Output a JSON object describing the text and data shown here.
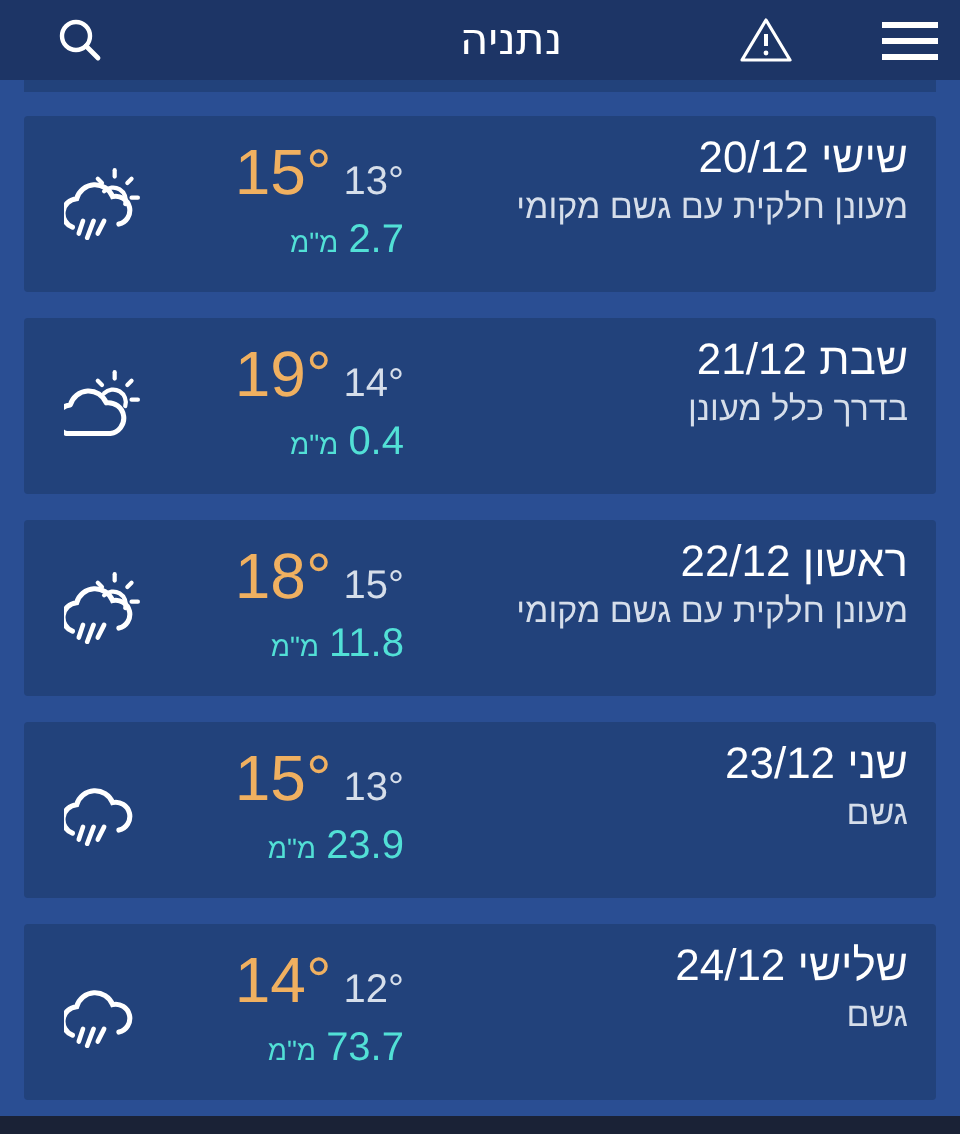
{
  "header": {
    "title": "נתניה"
  },
  "days": [
    {
      "day": "שישי 20/12",
      "description": "מעונן חלקית עם גשם מקומי",
      "high": "15°",
      "low": "13°",
      "precip": "2.7",
      "unit": "מ\"מ",
      "kind": "partly-rain"
    },
    {
      "day": "שבת 21/12",
      "description": "בדרך כלל מעונן",
      "high": "19°",
      "low": "14°",
      "precip": "0.4",
      "unit": "מ\"מ",
      "kind": "partly-cloudy"
    },
    {
      "day": "ראשון 22/12",
      "description": "מעונן חלקית עם גשם מקומי",
      "high": "18°",
      "low": "15°",
      "precip": "11.8",
      "unit": "מ\"מ",
      "kind": "partly-rain"
    },
    {
      "day": "שני 23/12",
      "description": "גשם",
      "high": "15°",
      "low": "13°",
      "precip": "23.9",
      "unit": "מ\"מ",
      "kind": "rain"
    },
    {
      "day": "שלישי 24/12",
      "description": "גשם",
      "high": "14°",
      "low": "12°",
      "precip": "73.7",
      "unit": "מ\"מ",
      "kind": "rain"
    }
  ]
}
